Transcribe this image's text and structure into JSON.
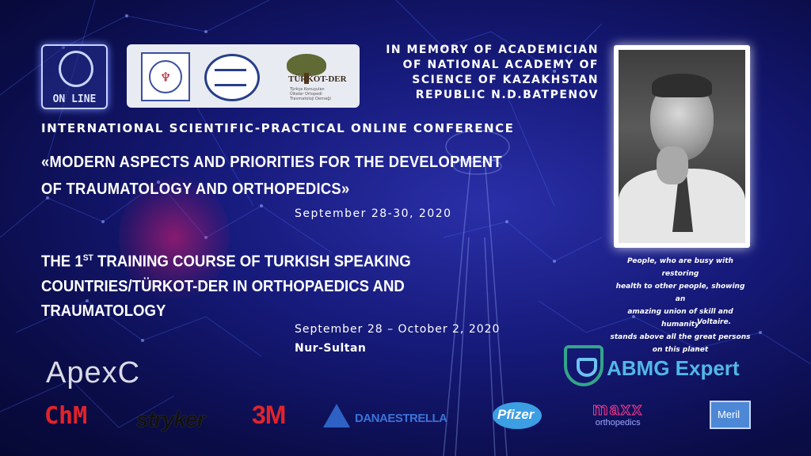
{
  "badge": {
    "label": "ON LINE",
    "icon": "headset-person-icon"
  },
  "logos": {
    "third_name": "TÜRKOT-DER",
    "third_sub": "Türkçe Konuşulan Ülkeler Ortopedi Travmatoloji Derneği"
  },
  "memorial": {
    "line1": "IN MEMORY OF ACADEMICIAN",
    "line2": "OF NATIONAL ACADEMY OF",
    "line3": "SCIENCE OF KAZAKHSTAN",
    "line4": "REPUBLIC N.D.BATPENOV"
  },
  "quote": {
    "line1": "People, who are busy with restoring",
    "line2": "health to other people, showing an",
    "line3": "amazing union of skill and humanity",
    "line4": "stands above all the great persons",
    "line5": "on this planet",
    "author": "Voltaire."
  },
  "conference": {
    "title": "INTERNATIONAL SCIENTIFIC-PRACTICAL ONLINE CONFERENCE",
    "name_line1": "«MODERN ASPECTS AND PRIORITIES FOR THE DEVELOPMENT",
    "name_line2": "OF TRAUMATOLOGY AND ORTHOPEDICS»",
    "dates": "September 28-30, 2020"
  },
  "course": {
    "prefix": "THE 1",
    "sup": "ST",
    "line1_rest": " TRAINING COURSE OF TURKISH SPEAKING",
    "line2": "COUNTRIES/TÜRKOT-DER IN ORTHOPAEDICS AND",
    "line3": "TRAUMATOLOGY",
    "dates": "September 28 – October 2, 2020",
    "city": "Nur-Sultan"
  },
  "sponsors": {
    "apexc": "ApexC",
    "abmg": "ABMG Expert",
    "chm": "ChM",
    "stryker": "stryker",
    "m3": "3M",
    "dana": "DANAESTRELLA",
    "pfizer": "Pfizer",
    "maxx": "maxx",
    "maxx_sub": "orthopedics",
    "meril": "Meril"
  },
  "colors": {
    "background": "#161a7a",
    "accent_red": "#e2232a",
    "abmg_blue": "#52b8e6",
    "abmg_green": "#33a58a"
  }
}
